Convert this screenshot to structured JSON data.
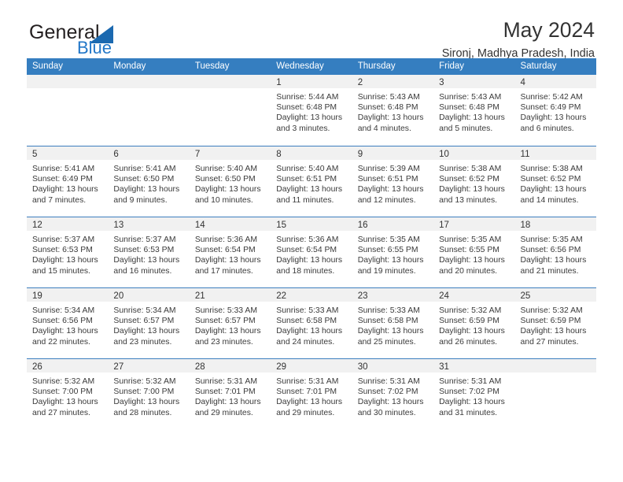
{
  "brand": {
    "name_part1": "General",
    "name_part2": "Blue",
    "mark": "triangle-logo",
    "accent_color": "#2277c8"
  },
  "header": {
    "title": "May 2024",
    "location": "Sironj, Madhya Pradesh, India"
  },
  "theme": {
    "header_bg": "#357ec0",
    "row_divider": "#3c7ebe",
    "day_strip_bg": "#f1f1f1",
    "text": "#333333"
  },
  "weekdays": [
    "Sunday",
    "Monday",
    "Tuesday",
    "Wednesday",
    "Thursday",
    "Friday",
    "Saturday"
  ],
  "weeks": [
    [
      {
        "day": "",
        "sunrise": "",
        "sunset": "",
        "daylight1": "",
        "daylight2": "",
        "empty": true
      },
      {
        "day": "",
        "sunrise": "",
        "sunset": "",
        "daylight1": "",
        "daylight2": "",
        "empty": true
      },
      {
        "day": "",
        "sunrise": "",
        "sunset": "",
        "daylight1": "",
        "daylight2": "",
        "empty": true
      },
      {
        "day": "1",
        "sunrise": "Sunrise: 5:44 AM",
        "sunset": "Sunset: 6:48 PM",
        "daylight1": "Daylight: 13 hours",
        "daylight2": "and 3 minutes.",
        "empty": false
      },
      {
        "day": "2",
        "sunrise": "Sunrise: 5:43 AM",
        "sunset": "Sunset: 6:48 PM",
        "daylight1": "Daylight: 13 hours",
        "daylight2": "and 4 minutes.",
        "empty": false
      },
      {
        "day": "3",
        "sunrise": "Sunrise: 5:43 AM",
        "sunset": "Sunset: 6:48 PM",
        "daylight1": "Daylight: 13 hours",
        "daylight2": "and 5 minutes.",
        "empty": false
      },
      {
        "day": "4",
        "sunrise": "Sunrise: 5:42 AM",
        "sunset": "Sunset: 6:49 PM",
        "daylight1": "Daylight: 13 hours",
        "daylight2": "and 6 minutes.",
        "empty": false
      }
    ],
    [
      {
        "day": "5",
        "sunrise": "Sunrise: 5:41 AM",
        "sunset": "Sunset: 6:49 PM",
        "daylight1": "Daylight: 13 hours",
        "daylight2": "and 7 minutes.",
        "empty": false
      },
      {
        "day": "6",
        "sunrise": "Sunrise: 5:41 AM",
        "sunset": "Sunset: 6:50 PM",
        "daylight1": "Daylight: 13 hours",
        "daylight2": "and 9 minutes.",
        "empty": false
      },
      {
        "day": "7",
        "sunrise": "Sunrise: 5:40 AM",
        "sunset": "Sunset: 6:50 PM",
        "daylight1": "Daylight: 13 hours",
        "daylight2": "and 10 minutes.",
        "empty": false
      },
      {
        "day": "8",
        "sunrise": "Sunrise: 5:40 AM",
        "sunset": "Sunset: 6:51 PM",
        "daylight1": "Daylight: 13 hours",
        "daylight2": "and 11 minutes.",
        "empty": false
      },
      {
        "day": "9",
        "sunrise": "Sunrise: 5:39 AM",
        "sunset": "Sunset: 6:51 PM",
        "daylight1": "Daylight: 13 hours",
        "daylight2": "and 12 minutes.",
        "empty": false
      },
      {
        "day": "10",
        "sunrise": "Sunrise: 5:38 AM",
        "sunset": "Sunset: 6:52 PM",
        "daylight1": "Daylight: 13 hours",
        "daylight2": "and 13 minutes.",
        "empty": false
      },
      {
        "day": "11",
        "sunrise": "Sunrise: 5:38 AM",
        "sunset": "Sunset: 6:52 PM",
        "daylight1": "Daylight: 13 hours",
        "daylight2": "and 14 minutes.",
        "empty": false
      }
    ],
    [
      {
        "day": "12",
        "sunrise": "Sunrise: 5:37 AM",
        "sunset": "Sunset: 6:53 PM",
        "daylight1": "Daylight: 13 hours",
        "daylight2": "and 15 minutes.",
        "empty": false
      },
      {
        "day": "13",
        "sunrise": "Sunrise: 5:37 AM",
        "sunset": "Sunset: 6:53 PM",
        "daylight1": "Daylight: 13 hours",
        "daylight2": "and 16 minutes.",
        "empty": false
      },
      {
        "day": "14",
        "sunrise": "Sunrise: 5:36 AM",
        "sunset": "Sunset: 6:54 PM",
        "daylight1": "Daylight: 13 hours",
        "daylight2": "and 17 minutes.",
        "empty": false
      },
      {
        "day": "15",
        "sunrise": "Sunrise: 5:36 AM",
        "sunset": "Sunset: 6:54 PM",
        "daylight1": "Daylight: 13 hours",
        "daylight2": "and 18 minutes.",
        "empty": false
      },
      {
        "day": "16",
        "sunrise": "Sunrise: 5:35 AM",
        "sunset": "Sunset: 6:55 PM",
        "daylight1": "Daylight: 13 hours",
        "daylight2": "and 19 minutes.",
        "empty": false
      },
      {
        "day": "17",
        "sunrise": "Sunrise: 5:35 AM",
        "sunset": "Sunset: 6:55 PM",
        "daylight1": "Daylight: 13 hours",
        "daylight2": "and 20 minutes.",
        "empty": false
      },
      {
        "day": "18",
        "sunrise": "Sunrise: 5:35 AM",
        "sunset": "Sunset: 6:56 PM",
        "daylight1": "Daylight: 13 hours",
        "daylight2": "and 21 minutes.",
        "empty": false
      }
    ],
    [
      {
        "day": "19",
        "sunrise": "Sunrise: 5:34 AM",
        "sunset": "Sunset: 6:56 PM",
        "daylight1": "Daylight: 13 hours",
        "daylight2": "and 22 minutes.",
        "empty": false
      },
      {
        "day": "20",
        "sunrise": "Sunrise: 5:34 AM",
        "sunset": "Sunset: 6:57 PM",
        "daylight1": "Daylight: 13 hours",
        "daylight2": "and 23 minutes.",
        "empty": false
      },
      {
        "day": "21",
        "sunrise": "Sunrise: 5:33 AM",
        "sunset": "Sunset: 6:57 PM",
        "daylight1": "Daylight: 13 hours",
        "daylight2": "and 23 minutes.",
        "empty": false
      },
      {
        "day": "22",
        "sunrise": "Sunrise: 5:33 AM",
        "sunset": "Sunset: 6:58 PM",
        "daylight1": "Daylight: 13 hours",
        "daylight2": "and 24 minutes.",
        "empty": false
      },
      {
        "day": "23",
        "sunrise": "Sunrise: 5:33 AM",
        "sunset": "Sunset: 6:58 PM",
        "daylight1": "Daylight: 13 hours",
        "daylight2": "and 25 minutes.",
        "empty": false
      },
      {
        "day": "24",
        "sunrise": "Sunrise: 5:32 AM",
        "sunset": "Sunset: 6:59 PM",
        "daylight1": "Daylight: 13 hours",
        "daylight2": "and 26 minutes.",
        "empty": false
      },
      {
        "day": "25",
        "sunrise": "Sunrise: 5:32 AM",
        "sunset": "Sunset: 6:59 PM",
        "daylight1": "Daylight: 13 hours",
        "daylight2": "and 27 minutes.",
        "empty": false
      }
    ],
    [
      {
        "day": "26",
        "sunrise": "Sunrise: 5:32 AM",
        "sunset": "Sunset: 7:00 PM",
        "daylight1": "Daylight: 13 hours",
        "daylight2": "and 27 minutes.",
        "empty": false
      },
      {
        "day": "27",
        "sunrise": "Sunrise: 5:32 AM",
        "sunset": "Sunset: 7:00 PM",
        "daylight1": "Daylight: 13 hours",
        "daylight2": "and 28 minutes.",
        "empty": false
      },
      {
        "day": "28",
        "sunrise": "Sunrise: 5:31 AM",
        "sunset": "Sunset: 7:01 PM",
        "daylight1": "Daylight: 13 hours",
        "daylight2": "and 29 minutes.",
        "empty": false
      },
      {
        "day": "29",
        "sunrise": "Sunrise: 5:31 AM",
        "sunset": "Sunset: 7:01 PM",
        "daylight1": "Daylight: 13 hours",
        "daylight2": "and 29 minutes.",
        "empty": false
      },
      {
        "day": "30",
        "sunrise": "Sunrise: 5:31 AM",
        "sunset": "Sunset: 7:02 PM",
        "daylight1": "Daylight: 13 hours",
        "daylight2": "and 30 minutes.",
        "empty": false
      },
      {
        "day": "31",
        "sunrise": "Sunrise: 5:31 AM",
        "sunset": "Sunset: 7:02 PM",
        "daylight1": "Daylight: 13 hours",
        "daylight2": "and 31 minutes.",
        "empty": false
      },
      {
        "day": "",
        "sunrise": "",
        "sunset": "",
        "daylight1": "",
        "daylight2": "",
        "empty": true
      }
    ]
  ]
}
